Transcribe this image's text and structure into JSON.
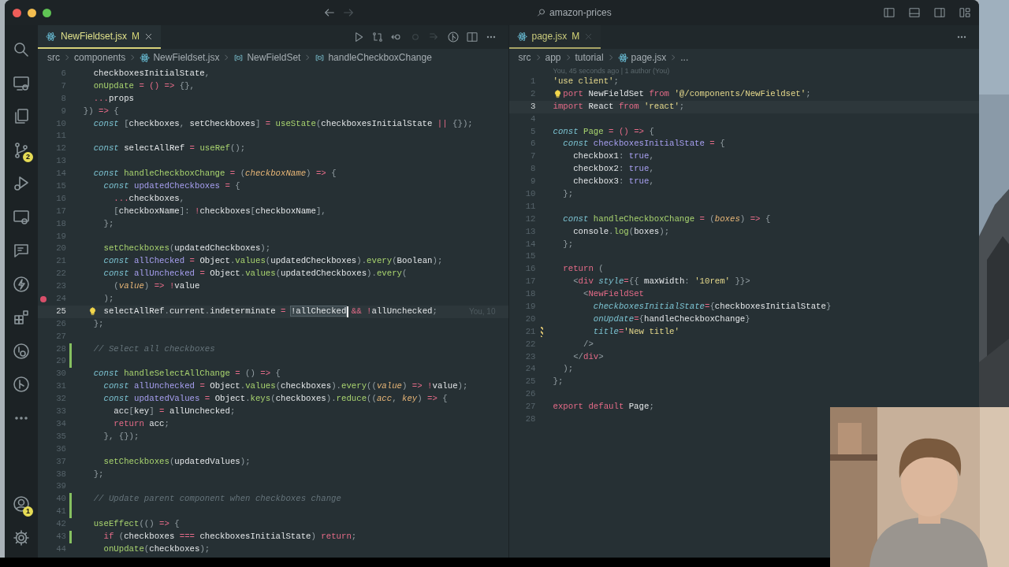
{
  "title_bar": {
    "search": "amazon-prices"
  },
  "activity_bar": {
    "items": [
      {
        "kind": "search"
      },
      {
        "kind": "remote"
      },
      {
        "kind": "explorer"
      },
      {
        "kind": "source-control",
        "badge": "2"
      },
      {
        "kind": "debug"
      },
      {
        "kind": "remote-explorer"
      },
      {
        "kind": "chat"
      },
      {
        "kind": "lightning"
      },
      {
        "kind": "extensions"
      },
      {
        "kind": "timeline"
      },
      {
        "kind": "git-graph"
      },
      {
        "kind": "more"
      }
    ],
    "bottom_items": [
      {
        "kind": "account",
        "badge": "1"
      },
      {
        "kind": "settings"
      }
    ]
  },
  "editors": [
    {
      "tab": {
        "label": "NewFieldset.jsx",
        "status": "M",
        "active": true
      },
      "toolbar": [
        {
          "kind": "run",
          "disabled": false
        },
        {
          "kind": "compare",
          "disabled": false
        },
        {
          "kind": "back",
          "disabled": false
        },
        {
          "kind": "dot",
          "disabled": true
        },
        {
          "kind": "forward",
          "disabled": true
        },
        {
          "kind": "git",
          "disabled": false
        },
        {
          "kind": "split",
          "disabled": false
        },
        {
          "kind": "more",
          "disabled": false
        }
      ],
      "breadcrumbs": [
        {
          "kind": "folder",
          "text": "src"
        },
        {
          "kind": "folder",
          "text": "components"
        },
        {
          "kind": "file",
          "text": "NewFieldset.jsx"
        },
        {
          "kind": "symbol",
          "text": "NewFieldSet"
        },
        {
          "kind": "symbol",
          "text": "handleCheckboxChange"
        }
      ],
      "lines": [
        {
          "number": "6",
          "tokens": [
            {
              "kind": "plain",
              "text": "    checkboxesInitialState"
            },
            {
              "kind": "punc",
              "text": ","
            }
          ]
        },
        {
          "number": "7",
          "tokens": [
            {
              "kind": "fn",
              "text": "    onUpdate"
            },
            {
              "kind": "op",
              "text": " = () => "
            },
            {
              "kind": "punc",
              "text": "{},"
            }
          ]
        },
        {
          "number": "8",
          "tokens": [
            {
              "kind": "op",
              "text": "    ..."
            },
            {
              "kind": "plain",
              "text": "props"
            }
          ]
        },
        {
          "number": "9",
          "tokens": [
            {
              "kind": "punc",
              "text": "  })"
            },
            {
              "kind": "op",
              "text": " => "
            },
            {
              "kind": "punc",
              "text": "{"
            }
          ]
        },
        {
          "number": "10",
          "tokens": [
            {
              "kind": "kw",
              "text": "    const"
            },
            {
              "kind": "punc",
              "text": " ["
            },
            {
              "kind": "plain",
              "text": "checkboxes"
            },
            {
              "kind": "punc",
              "text": ", "
            },
            {
              "kind": "plain",
              "text": "setCheckboxes"
            },
            {
              "kind": "punc",
              "text": "]"
            },
            {
              "kind": "op",
              "text": " = "
            },
            {
              "kind": "fn",
              "text": "useState"
            },
            {
              "kind": "punc",
              "text": "("
            },
            {
              "kind": "plain",
              "text": "checkboxesInitialState"
            },
            {
              "kind": "op",
              "text": " || "
            },
            {
              "kind": "punc",
              "text": "{});"
            }
          ]
        },
        {
          "number": "11"
        },
        {
          "number": "12",
          "tokens": [
            {
              "kind": "kw",
              "text": "    const"
            },
            {
              "kind": "plain",
              "text": " selectAllRef"
            },
            {
              "kind": "op",
              "text": " = "
            },
            {
              "kind": "fn",
              "text": "useRef"
            },
            {
              "kind": "punc",
              "text": "();"
            }
          ]
        },
        {
          "number": "13"
        },
        {
          "number": "14",
          "tokens": [
            {
              "kind": "kw",
              "text": "    const"
            },
            {
              "kind": "fn",
              "text": " handleCheckboxChange"
            },
            {
              "kind": "op",
              "text": " = "
            },
            {
              "kind": "punc",
              "text": "("
            },
            {
              "kind": "param",
              "text": "checkboxName"
            },
            {
              "kind": "punc",
              "text": ")"
            },
            {
              "kind": "op",
              "text": " => "
            },
            {
              "kind": "punc",
              "text": "{"
            }
          ]
        },
        {
          "number": "15",
          "tokens": [
            {
              "kind": "kw",
              "text": "      const"
            },
            {
              "kind": "decl",
              "text": " updatedCheckboxes"
            },
            {
              "kind": "op",
              "text": " = "
            },
            {
              "kind": "punc",
              "text": "{"
            }
          ]
        },
        {
          "number": "16",
          "tokens": [
            {
              "kind": "op",
              "text": "        ..."
            },
            {
              "kind": "plain",
              "text": "checkboxes"
            },
            {
              "kind": "punc",
              "text": ","
            }
          ]
        },
        {
          "number": "17",
          "tokens": [
            {
              "kind": "punc",
              "text": "        ["
            },
            {
              "kind": "plain",
              "text": "checkboxName"
            },
            {
              "kind": "punc",
              "text": "]: "
            },
            {
              "kind": "op",
              "text": "!"
            },
            {
              "kind": "plain",
              "text": "checkboxes"
            },
            {
              "kind": "punc",
              "text": "["
            },
            {
              "kind": "plain",
              "text": "checkboxName"
            },
            {
              "kind": "punc",
              "text": "],"
            }
          ]
        },
        {
          "number": "18",
          "tokens": [
            {
              "kind": "punc",
              "text": "      };"
            }
          ]
        },
        {
          "number": "19"
        },
        {
          "number": "20",
          "tokens": [
            {
              "kind": "fn",
              "text": "      setCheckboxes"
            },
            {
              "kind": "punc",
              "text": "("
            },
            {
              "kind": "plain",
              "text": "updatedCheckboxes"
            },
            {
              "kind": "punc",
              "text": ");"
            }
          ]
        },
        {
          "number": "21",
          "tokens": [
            {
              "kind": "kw",
              "text": "      const"
            },
            {
              "kind": "decl",
              "text": " allChecked"
            },
            {
              "kind": "op",
              "text": " = "
            },
            {
              "kind": "plain",
              "text": "Object"
            },
            {
              "kind": "punc",
              "text": "."
            },
            {
              "kind": "fn",
              "text": "values"
            },
            {
              "kind": "punc",
              "text": "("
            },
            {
              "kind": "plain",
              "text": "updatedCheckboxes"
            },
            {
              "kind": "punc",
              "text": ")."
            },
            {
              "kind": "fn",
              "text": "every"
            },
            {
              "kind": "punc",
              "text": "("
            },
            {
              "kind": "plain",
              "text": "Boolean"
            },
            {
              "kind": "punc",
              "text": ");"
            }
          ]
        },
        {
          "number": "22",
          "tokens": [
            {
              "kind": "kw",
              "text": "      const"
            },
            {
              "kind": "decl",
              "text": " allUnchecked"
            },
            {
              "kind": "op",
              "text": " = "
            },
            {
              "kind": "plain",
              "text": "Object"
            },
            {
              "kind": "punc",
              "text": "."
            },
            {
              "kind": "fn",
              "text": "values"
            },
            {
              "kind": "punc",
              "text": "("
            },
            {
              "kind": "plain",
              "text": "updatedCheckboxes"
            },
            {
              "kind": "punc",
              "text": ")."
            },
            {
              "kind": "fn",
              "text": "every"
            },
            {
              "kind": "punc",
              "text": "("
            }
          ]
        },
        {
          "number": "23",
          "tokens": [
            {
              "kind": "punc",
              "text": "        ("
            },
            {
              "kind": "param",
              "text": "value"
            },
            {
              "kind": "punc",
              "text": ")"
            },
            {
              "kind": "op",
              "text": " => !"
            },
            {
              "kind": "plain",
              "text": "value"
            }
          ]
        },
        {
          "number": "24",
          "breakpoint": true,
          "tokens": [
            {
              "kind": "punc",
              "text": "      );"
            }
          ]
        },
        {
          "number": "25",
          "current": true,
          "lightbulb": true,
          "cursor": true,
          "blame": "You, 10",
          "tokens": [
            {
              "kind": "plain",
              "text": "      selectAllRef"
            },
            {
              "kind": "punc",
              "text": "."
            },
            {
              "kind": "plain",
              "text": "current"
            },
            {
              "kind": "punc",
              "text": "."
            },
            {
              "kind": "plain",
              "text": "indeterminate"
            },
            {
              "kind": "op",
              "text": " = "
            },
            {
              "kind": "match",
              "text": "!allChecked"
            },
            {
              "kind": "op",
              "text": " && !"
            },
            {
              "kind": "plain",
              "text": "allUnchecked"
            },
            {
              "kind": "punc",
              "text": ";"
            }
          ]
        },
        {
          "number": "26",
          "tokens": [
            {
              "kind": "punc",
              "text": "    };"
            }
          ]
        },
        {
          "number": "27"
        },
        {
          "number": "28",
          "added": true,
          "tokens": [
            {
              "kind": "com",
              "text": "    // Select all checkboxes"
            }
          ]
        },
        {
          "number": "29",
          "added": true
        },
        {
          "number": "30",
          "tokens": [
            {
              "kind": "kw",
              "text": "    const"
            },
            {
              "kind": "fn",
              "text": " handleSelectAllChange"
            },
            {
              "kind": "op",
              "text": " = "
            },
            {
              "kind": "punc",
              "text": "() "
            },
            {
              "kind": "op",
              "text": "=> "
            },
            {
              "kind": "punc",
              "text": "{"
            }
          ]
        },
        {
          "number": "31",
          "tokens": [
            {
              "kind": "kw",
              "text": "      const"
            },
            {
              "kind": "decl",
              "text": " allUnchecked"
            },
            {
              "kind": "op",
              "text": " = "
            },
            {
              "kind": "plain",
              "text": "Object"
            },
            {
              "kind": "punc",
              "text": "."
            },
            {
              "kind": "fn",
              "text": "values"
            },
            {
              "kind": "punc",
              "text": "("
            },
            {
              "kind": "plain",
              "text": "checkboxes"
            },
            {
              "kind": "punc",
              "text": ")."
            },
            {
              "kind": "fn",
              "text": "every"
            },
            {
              "kind": "punc",
              "text": "(("
            },
            {
              "kind": "param",
              "text": "value"
            },
            {
              "kind": "punc",
              "text": ")"
            },
            {
              "kind": "op",
              "text": " => !"
            },
            {
              "kind": "plain",
              "text": "value"
            },
            {
              "kind": "punc",
              "text": ");"
            }
          ]
        },
        {
          "number": "32",
          "tokens": [
            {
              "kind": "kw",
              "text": "      const"
            },
            {
              "kind": "decl",
              "text": " updatedValues"
            },
            {
              "kind": "op",
              "text": " = "
            },
            {
              "kind": "plain",
              "text": "Object"
            },
            {
              "kind": "punc",
              "text": "."
            },
            {
              "kind": "fn",
              "text": "keys"
            },
            {
              "kind": "punc",
              "text": "("
            },
            {
              "kind": "plain",
              "text": "checkboxes"
            },
            {
              "kind": "punc",
              "text": ")."
            },
            {
              "kind": "fn",
              "text": "reduce"
            },
            {
              "kind": "punc",
              "text": "(("
            },
            {
              "kind": "param",
              "text": "acc"
            },
            {
              "kind": "punc",
              "text": ", "
            },
            {
              "kind": "param",
              "text": "key"
            },
            {
              "kind": "punc",
              "text": ")"
            },
            {
              "kind": "op",
              "text": " => "
            },
            {
              "kind": "punc",
              "text": "{"
            }
          ]
        },
        {
          "number": "33",
          "tokens": [
            {
              "kind": "plain",
              "text": "        acc"
            },
            {
              "kind": "punc",
              "text": "["
            },
            {
              "kind": "plain",
              "text": "key"
            },
            {
              "kind": "punc",
              "text": "]"
            },
            {
              "kind": "op",
              "text": " = "
            },
            {
              "kind": "plain",
              "text": "allUnchecked"
            },
            {
              "kind": "punc",
              "text": ";"
            }
          ]
        },
        {
          "number": "34",
          "tokens": [
            {
              "kind": "ctrl",
              "text": "        return"
            },
            {
              "kind": "plain",
              "text": " acc"
            },
            {
              "kind": "punc",
              "text": ";"
            }
          ]
        },
        {
          "number": "35",
          "tokens": [
            {
              "kind": "punc",
              "text": "      }, {});"
            }
          ]
        },
        {
          "number": "36"
        },
        {
          "number": "37",
          "tokens": [
            {
              "kind": "fn",
              "text": "      setCheckboxes"
            },
            {
              "kind": "punc",
              "text": "("
            },
            {
              "kind": "plain",
              "text": "updatedValues"
            },
            {
              "kind": "punc",
              "text": ");"
            }
          ]
        },
        {
          "number": "38",
          "tokens": [
            {
              "kind": "punc",
              "text": "    };"
            }
          ]
        },
        {
          "number": "39"
        },
        {
          "number": "40",
          "added": true,
          "tokens": [
            {
              "kind": "com",
              "text": "    // Update parent component when checkboxes change"
            }
          ]
        },
        {
          "number": "41",
          "added": true
        },
        {
          "number": "42",
          "tokens": [
            {
              "kind": "fn",
              "text": "    useEffect"
            },
            {
              "kind": "punc",
              "text": "(()"
            },
            {
              "kind": "op",
              "text": " => "
            },
            {
              "kind": "punc",
              "text": "{"
            }
          ]
        },
        {
          "number": "43",
          "added": true,
          "tokens": [
            {
              "kind": "ctrl",
              "text": "      if"
            },
            {
              "kind": "punc",
              "text": " ("
            },
            {
              "kind": "plain",
              "text": "checkboxes"
            },
            {
              "kind": "op",
              "text": " === "
            },
            {
              "kind": "plain",
              "text": "checkboxesInitialState"
            },
            {
              "kind": "punc",
              "text": ") "
            },
            {
              "kind": "ctrl",
              "text": "return"
            },
            {
              "kind": "punc",
              "text": ";"
            }
          ]
        },
        {
          "number": "44",
          "tokens": [
            {
              "kind": "fn",
              "text": "      onUpdate"
            },
            {
              "kind": "punc",
              "text": "("
            },
            {
              "kind": "plain",
              "text": "checkboxes"
            },
            {
              "kind": "punc",
              "text": ");"
            }
          ]
        }
      ]
    },
    {
      "tab": {
        "label": "page.jsx",
        "status": "M",
        "active": false
      },
      "toolbar": [
        {
          "kind": "more",
          "disabled": false
        }
      ],
      "breadcrumbs": [
        {
          "kind": "folder",
          "text": "src"
        },
        {
          "kind": "folder",
          "text": "app"
        },
        {
          "kind": "folder",
          "text": "tutorial"
        },
        {
          "kind": "file",
          "text": "page.jsx"
        },
        {
          "kind": "folder",
          "text": "..."
        }
      ],
      "blame": "You, 45 seconds ago | 1 author (You)",
      "lines": [
        {
          "number": "1",
          "tokens": [
            {
              "kind": "str",
              "text": "'use client'"
            },
            {
              "kind": "punc",
              "text": ";"
            }
          ]
        },
        {
          "number": "2",
          "lightbulb": true,
          "tokens": [
            {
              "kind": "ctrl",
              "text": "port"
            },
            {
              "kind": "plain",
              "text": " NewFieldSet "
            },
            {
              "kind": "ctrl",
              "text": "from"
            },
            {
              "kind": "str",
              "text": " '@/components/NewFieldset'"
            },
            {
              "kind": "punc",
              "text": ";"
            }
          ]
        },
        {
          "number": "3",
          "current": true,
          "tokens": [
            {
              "kind": "ctrl",
              "text": "import"
            },
            {
              "kind": "plain",
              "text": " React "
            },
            {
              "kind": "ctrl",
              "text": "from"
            },
            {
              "kind": "str",
              "text": " 'react'"
            },
            {
              "kind": "punc",
              "text": ";"
            }
          ]
        },
        {
          "number": "4"
        },
        {
          "number": "5",
          "tokens": [
            {
              "kind": "kw",
              "text": "const"
            },
            {
              "kind": "fn",
              "text": " Page"
            },
            {
              "kind": "op",
              "text": " = () => "
            },
            {
              "kind": "punc",
              "text": "{"
            }
          ]
        },
        {
          "number": "6",
          "tokens": [
            {
              "kind": "kw",
              "text": "  const"
            },
            {
              "kind": "decl",
              "text": " checkboxesInitialState"
            },
            {
              "kind": "op",
              "text": " = "
            },
            {
              "kind": "punc",
              "text": "{"
            }
          ]
        },
        {
          "number": "7",
          "tokens": [
            {
              "kind": "plain",
              "text": "    checkbox1"
            },
            {
              "kind": "punc",
              "text": ": "
            },
            {
              "kind": "bool",
              "text": "true"
            },
            {
              "kind": "punc",
              "text": ","
            }
          ]
        },
        {
          "number": "8",
          "tokens": [
            {
              "kind": "plain",
              "text": "    checkbox2"
            },
            {
              "kind": "punc",
              "text": ": "
            },
            {
              "kind": "bool",
              "text": "true"
            },
            {
              "kind": "punc",
              "text": ","
            }
          ]
        },
        {
          "number": "9",
          "tokens": [
            {
              "kind": "plain",
              "text": "    checkbox3"
            },
            {
              "kind": "punc",
              "text": ": "
            },
            {
              "kind": "bool",
              "text": "true"
            },
            {
              "kind": "punc",
              "text": ","
            }
          ]
        },
        {
          "number": "10",
          "tokens": [
            {
              "kind": "punc",
              "text": "  };"
            }
          ]
        },
        {
          "number": "11"
        },
        {
          "number": "12",
          "tokens": [
            {
              "kind": "kw",
              "text": "  const"
            },
            {
              "kind": "fn",
              "text": " handleCheckboxChange"
            },
            {
              "kind": "op",
              "text": " = "
            },
            {
              "kind": "punc",
              "text": "("
            },
            {
              "kind": "param",
              "text": "boxes"
            },
            {
              "kind": "punc",
              "text": ")"
            },
            {
              "kind": "op",
              "text": " => "
            },
            {
              "kind": "punc",
              "text": "{"
            }
          ]
        },
        {
          "number": "13",
          "tokens": [
            {
              "kind": "plain",
              "text": "    console"
            },
            {
              "kind": "punc",
              "text": "."
            },
            {
              "kind": "fn",
              "text": "log"
            },
            {
              "kind": "punc",
              "text": "("
            },
            {
              "kind": "plain",
              "text": "boxes"
            },
            {
              "kind": "punc",
              "text": ");"
            }
          ]
        },
        {
          "number": "14",
          "tokens": [
            {
              "kind": "punc",
              "text": "  };"
            }
          ]
        },
        {
          "number": "15"
        },
        {
          "number": "16",
          "tokens": [
            {
              "kind": "ctrl",
              "text": "  return"
            },
            {
              "kind": "punc",
              "text": " ("
            }
          ]
        },
        {
          "number": "17",
          "tokens": [
            {
              "kind": "punc",
              "text": "    <"
            },
            {
              "kind": "tag",
              "text": "div"
            },
            {
              "kind": "attr",
              "text": " style"
            },
            {
              "kind": "op",
              "text": "="
            },
            {
              "kind": "punc",
              "text": "{{ "
            },
            {
              "kind": "plain",
              "text": "maxWidth"
            },
            {
              "kind": "punc",
              "text": ": "
            },
            {
              "kind": "str",
              "text": "'10rem'"
            },
            {
              "kind": "punc",
              "text": " }}>"
            }
          ]
        },
        {
          "number": "18",
          "tokens": [
            {
              "kind": "punc",
              "text": "      <"
            },
            {
              "kind": "tag",
              "text": "NewFieldSet"
            }
          ]
        },
        {
          "number": "19",
          "tokens": [
            {
              "kind": "attr",
              "text": "        checkboxesInitialState"
            },
            {
              "kind": "op",
              "text": "="
            },
            {
              "kind": "punc",
              "text": "{"
            },
            {
              "kind": "plain",
              "text": "checkboxesInitialState"
            },
            {
              "kind": "punc",
              "text": "}"
            }
          ]
        },
        {
          "number": "20",
          "tokens": [
            {
              "kind": "attr",
              "text": "        onUpdate"
            },
            {
              "kind": "op",
              "text": "="
            },
            {
              "kind": "punc",
              "text": "{"
            },
            {
              "kind": "plain",
              "text": "handleCheckboxChange"
            },
            {
              "kind": "punc",
              "text": "}"
            }
          ]
        },
        {
          "number": "21",
          "modified": true,
          "tokens": [
            {
              "kind": "attr",
              "text": "        title"
            },
            {
              "kind": "op",
              "text": "="
            },
            {
              "kind": "str",
              "text": "'New title'"
            }
          ]
        },
        {
          "number": "22",
          "tokens": [
            {
              "kind": "punc",
              "text": "      />"
            }
          ]
        },
        {
          "number": "23",
          "tokens": [
            {
              "kind": "punc",
              "text": "    </"
            },
            {
              "kind": "tag",
              "text": "div"
            },
            {
              "kind": "punc",
              "text": ">"
            }
          ]
        },
        {
          "number": "24",
          "tokens": [
            {
              "kind": "punc",
              "text": "  );"
            }
          ]
        },
        {
          "number": "25",
          "tokens": [
            {
              "kind": "punc",
              "text": "};"
            }
          ]
        },
        {
          "number": "26"
        },
        {
          "number": "27",
          "tokens": [
            {
              "kind": "ctrl",
              "text": "export default"
            },
            {
              "kind": "plain",
              "text": " Page"
            },
            {
              "kind": "punc",
              "text": ";"
            }
          ]
        },
        {
          "number": "28"
        }
      ]
    }
  ]
}
